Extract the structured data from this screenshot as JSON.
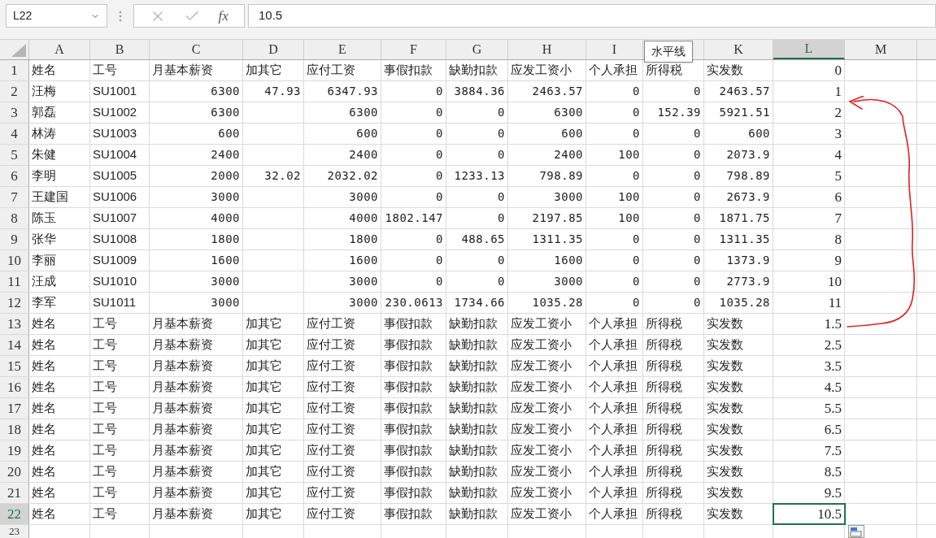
{
  "name_box": "L22",
  "formula_bar": {
    "fx_label": "fx",
    "value": "10.5"
  },
  "columns": [
    {
      "label": "A",
      "selected": false
    },
    {
      "label": "B",
      "selected": false
    },
    {
      "label": "C",
      "selected": false
    },
    {
      "label": "D",
      "selected": false
    },
    {
      "label": "E",
      "selected": false
    },
    {
      "label": "F",
      "selected": false
    },
    {
      "label": "G",
      "selected": false
    },
    {
      "label": "H",
      "selected": false
    },
    {
      "label": "I",
      "selected": false
    },
    {
      "selected": false
    },
    {
      "label": "K",
      "selected": false
    },
    {
      "label": "L",
      "selected": true
    },
    {
      "label": "M",
      "selected": false
    }
  ],
  "rows": [
    {
      "number": "1",
      "selected": false,
      "kind": "header",
      "cells": {
        "A": "姓名",
        "B": "工号",
        "C": "月基本薪资",
        "D": "加其它",
        "E": "应付工资",
        "F": "事假扣款",
        "G": "缺勤扣款",
        "H": "应发工资小",
        "I": "个人承担",
        "J": "所得税",
        "K": "实发数",
        "L": "0"
      }
    },
    {
      "number": "2",
      "selected": false,
      "kind": "data",
      "cells": {
        "A": "汪梅",
        "B": "SU1001",
        "C": "6300",
        "D": "47.93",
        "E": "6347.93",
        "F": "0",
        "G": "3884.36",
        "H": "2463.57",
        "I": "0",
        "J": "0",
        "K": "2463.57",
        "L": "1"
      }
    },
    {
      "number": "3",
      "selected": false,
      "kind": "data",
      "cells": {
        "A": "郭磊",
        "B": "SU1002",
        "C": "6300",
        "E": "6300",
        "F": "0",
        "G": "0",
        "H": "6300",
        "I": "0",
        "J": "152.39",
        "K": "5921.51",
        "L": "2"
      }
    },
    {
      "number": "4",
      "selected": false,
      "kind": "data",
      "cells": {
        "A": "林涛",
        "B": "SU1003",
        "C": "600",
        "E": "600",
        "F": "0",
        "G": "0",
        "H": "600",
        "I": "0",
        "J": "0",
        "K": "600",
        "L": "3"
      }
    },
    {
      "number": "5",
      "selected": false,
      "kind": "data",
      "cells": {
        "A": "朱健",
        "B": "SU1004",
        "C": "2400",
        "E": "2400",
        "F": "0",
        "G": "0",
        "H": "2400",
        "I": "100",
        "J": "0",
        "K": "2073.9",
        "L": "4"
      }
    },
    {
      "number": "6",
      "selected": false,
      "kind": "data",
      "cells": {
        "A": "李明",
        "B": "SU1005",
        "C": "2000",
        "D": "32.02",
        "E": "2032.02",
        "F": "0",
        "G": "1233.13",
        "H": "798.89",
        "I": "0",
        "J": "0",
        "K": "798.89",
        "L": "5"
      }
    },
    {
      "number": "7",
      "selected": false,
      "kind": "data",
      "cells": {
        "A": "王建国",
        "B": "SU1006",
        "C": "3000",
        "E": "3000",
        "F": "0",
        "G": "0",
        "H": "3000",
        "I": "100",
        "J": "0",
        "K": "2673.9",
        "L": "6"
      }
    },
    {
      "number": "8",
      "selected": false,
      "kind": "data",
      "cells": {
        "A": "陈玉",
        "B": "SU1007",
        "C": "4000",
        "E": "4000",
        "F": "1802.147",
        "G": "0",
        "H": "2197.85",
        "I": "100",
        "J": "0",
        "K": "1871.75",
        "L": "7"
      }
    },
    {
      "number": "9",
      "selected": false,
      "kind": "data",
      "cells": {
        "A": "张华",
        "B": "SU1008",
        "C": "1800",
        "E": "1800",
        "F": "0",
        "G": "488.65",
        "H": "1311.35",
        "I": "0",
        "J": "0",
        "K": "1311.35",
        "L": "8"
      }
    },
    {
      "number": "10",
      "selected": false,
      "kind": "data",
      "cells": {
        "A": "李丽",
        "B": "SU1009",
        "C": "1600",
        "E": "1600",
        "F": "0",
        "G": "0",
        "H": "1600",
        "I": "0",
        "J": "0",
        "K": "1373.9",
        "L": "9"
      }
    },
    {
      "number": "11",
      "selected": false,
      "kind": "data",
      "cells": {
        "A": "汪成",
        "B": "SU1010",
        "C": "3000",
        "E": "3000",
        "F": "0",
        "G": "0",
        "H": "3000",
        "I": "0",
        "J": "0",
        "K": "2773.9",
        "L": "10"
      }
    },
    {
      "number": "12",
      "selected": false,
      "kind": "data",
      "cells": {
        "A": "李军",
        "B": "SU1011",
        "C": "3000",
        "E": "3000",
        "F": "230.0613",
        "G": "1734.66",
        "H": "1035.28",
        "I": "0",
        "J": "0",
        "K": "1035.28",
        "L": "11"
      }
    },
    {
      "number": "13",
      "selected": false,
      "kind": "header",
      "cells": {
        "A": "姓名",
        "B": "工号",
        "C": "月基本薪资",
        "D": "加其它",
        "E": "应付工资",
        "F": "事假扣款",
        "G": "缺勤扣款",
        "H": "应发工资小",
        "I": "个人承担",
        "J": "所得税",
        "K": "实发数",
        "L": "1.5"
      }
    },
    {
      "number": "14",
      "selected": false,
      "kind": "header",
      "cells": {
        "A": "姓名",
        "B": "工号",
        "C": "月基本薪资",
        "D": "加其它",
        "E": "应付工资",
        "F": "事假扣款",
        "G": "缺勤扣款",
        "H": "应发工资小",
        "I": "个人承担",
        "J": "所得税",
        "K": "实发数",
        "L": "2.5"
      }
    },
    {
      "number": "15",
      "selected": false,
      "kind": "header",
      "cells": {
        "A": "姓名",
        "B": "工号",
        "C": "月基本薪资",
        "D": "加其它",
        "E": "应付工资",
        "F": "事假扣款",
        "G": "缺勤扣款",
        "H": "应发工资小",
        "I": "个人承担",
        "J": "所得税",
        "K": "实发数",
        "L": "3.5"
      }
    },
    {
      "number": "16",
      "selected": false,
      "kind": "header",
      "cells": {
        "A": "姓名",
        "B": "工号",
        "C": "月基本薪资",
        "D": "加其它",
        "E": "应付工资",
        "F": "事假扣款",
        "G": "缺勤扣款",
        "H": "应发工资小",
        "I": "个人承担",
        "J": "所得税",
        "K": "实发数",
        "L": "4.5"
      }
    },
    {
      "number": "17",
      "selected": false,
      "kind": "header",
      "cells": {
        "A": "姓名",
        "B": "工号",
        "C": "月基本薪资",
        "D": "加其它",
        "E": "应付工资",
        "F": "事假扣款",
        "G": "缺勤扣款",
        "H": "应发工资小",
        "I": "个人承担",
        "J": "所得税",
        "K": "实发数",
        "L": "5.5"
      }
    },
    {
      "number": "18",
      "selected": false,
      "kind": "header",
      "cells": {
        "A": "姓名",
        "B": "工号",
        "C": "月基本薪资",
        "D": "加其它",
        "E": "应付工资",
        "F": "事假扣款",
        "G": "缺勤扣款",
        "H": "应发工资小",
        "I": "个人承担",
        "J": "所得税",
        "K": "实发数",
        "L": "6.5"
      }
    },
    {
      "number": "19",
      "selected": false,
      "kind": "header",
      "cells": {
        "A": "姓名",
        "B": "工号",
        "C": "月基本薪资",
        "D": "加其它",
        "E": "应付工资",
        "F": "事假扣款",
        "G": "缺勤扣款",
        "H": "应发工资小",
        "I": "个人承担",
        "J": "所得税",
        "K": "实发数",
        "L": "7.5"
      }
    },
    {
      "number": "20",
      "selected": false,
      "kind": "header",
      "cells": {
        "A": "姓名",
        "B": "工号",
        "C": "月基本薪资",
        "D": "加其它",
        "E": "应付工资",
        "F": "事假扣款",
        "G": "缺勤扣款",
        "H": "应发工资小",
        "I": "个人承担",
        "J": "所得税",
        "K": "实发数",
        "L": "8.5"
      }
    },
    {
      "number": "21",
      "selected": false,
      "kind": "header",
      "cells": {
        "A": "姓名",
        "B": "工号",
        "C": "月基本薪资",
        "D": "加其它",
        "E": "应付工资",
        "F": "事假扣款",
        "G": "缺勤扣款",
        "H": "应发工资小",
        "I": "个人承担",
        "J": "所得税",
        "K": "实发数",
        "L": "9.5"
      }
    },
    {
      "number": "22",
      "selected": true,
      "kind": "header",
      "cells": {
        "A": "姓名",
        "B": "工号",
        "C": "月基本薪资",
        "D": "加其它",
        "E": "应付工资",
        "F": "事假扣款",
        "G": "缺勤扣款",
        "H": "应发工资小",
        "I": "个人承担",
        "J": "所得税",
        "K": "实发数",
        "L": "10.5"
      }
    },
    {
      "number": "23",
      "selected": false,
      "kind": "data",
      "cells": {}
    }
  ],
  "tooltip": "水平线"
}
